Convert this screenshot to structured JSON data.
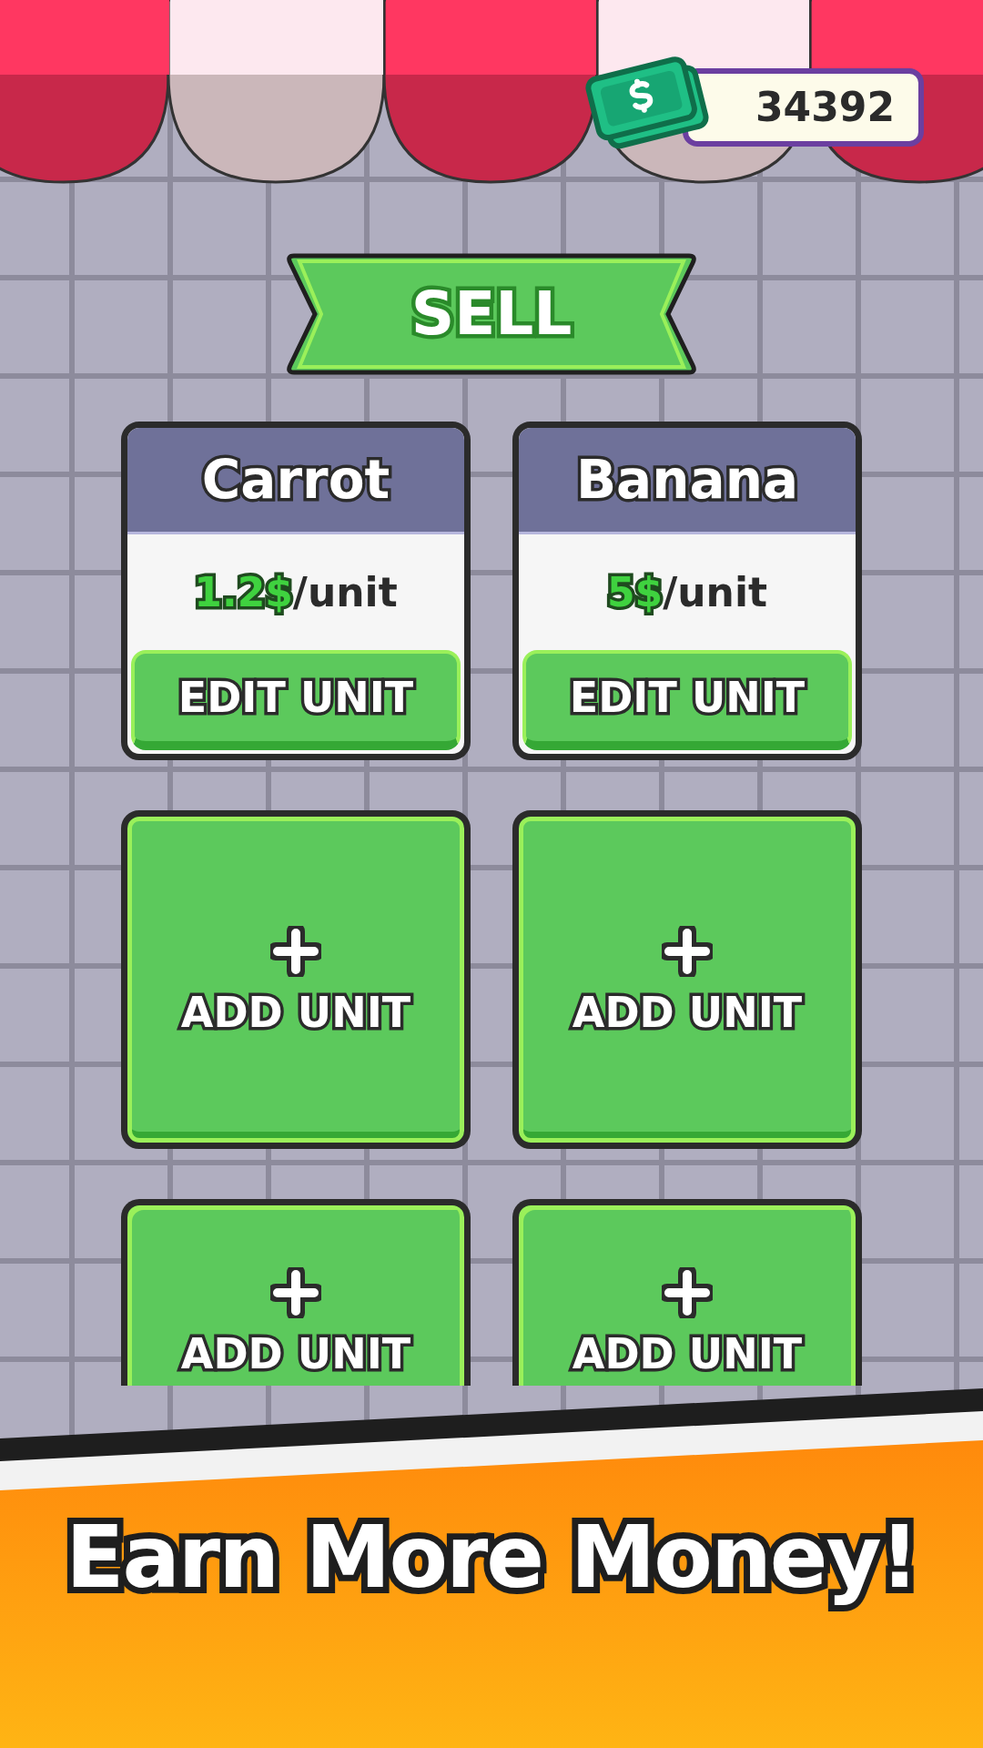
{
  "wallet": {
    "balance": "34392"
  },
  "header": {
    "title": "SELL"
  },
  "slots": [
    {
      "kind": "product",
      "name": "Carrot",
      "price": "1.2$",
      "per": "/unit",
      "button": "EDIT UNIT"
    },
    {
      "kind": "product",
      "name": "Banana",
      "price": "5$",
      "per": "/unit",
      "button": "EDIT UNIT"
    },
    {
      "kind": "empty",
      "button": "ADD UNIT"
    },
    {
      "kind": "empty",
      "button": "ADD UNIT"
    },
    {
      "kind": "empty",
      "button": "ADD UNIT"
    },
    {
      "kind": "empty",
      "button": "ADD UNIT"
    }
  ],
  "banner": {
    "headline": "Earn More Money!"
  }
}
